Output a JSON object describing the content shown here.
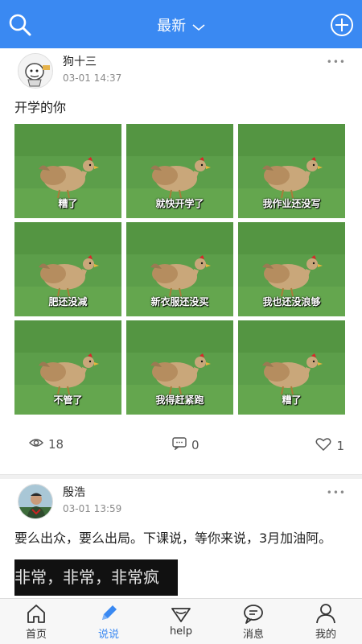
{
  "header": {
    "title": "最新",
    "left_icon": "search-icon",
    "right_icon": "add-circle-icon",
    "bg_color": "#3a89f2"
  },
  "posts": [
    {
      "username": "狗十三",
      "time": "03-01 14:37",
      "more": "•••",
      "text": "开学的你",
      "images": [
        {
          "caption": "糟了"
        },
        {
          "caption": "就快开学了"
        },
        {
          "caption": "我作业还没写"
        },
        {
          "caption": "肥还没减"
        },
        {
          "caption": "新衣服还没买"
        },
        {
          "caption": "我也还没浪够"
        },
        {
          "caption": "不管了"
        },
        {
          "caption": "我得赶紧跑"
        },
        {
          "caption": "糟了"
        }
      ],
      "views": "18",
      "comments": "0",
      "likes": "1"
    },
    {
      "username": "殷浩",
      "time": "03-01 13:59",
      "more": "•••",
      "text": "要么出众，要么出局。下课说，等你来说，3月加油阿。",
      "video_caption": "非常，非常，非常疯"
    }
  ],
  "tabbar": {
    "tabs": [
      {
        "label": "首页",
        "icon": "home-icon"
      },
      {
        "label": "说说",
        "icon": "pencil-icon"
      },
      {
        "label": "help",
        "icon": "help-icon"
      },
      {
        "label": "消息",
        "icon": "message-icon"
      },
      {
        "label": "我的",
        "icon": "person-icon"
      }
    ],
    "active_color": "#3a89f2"
  }
}
